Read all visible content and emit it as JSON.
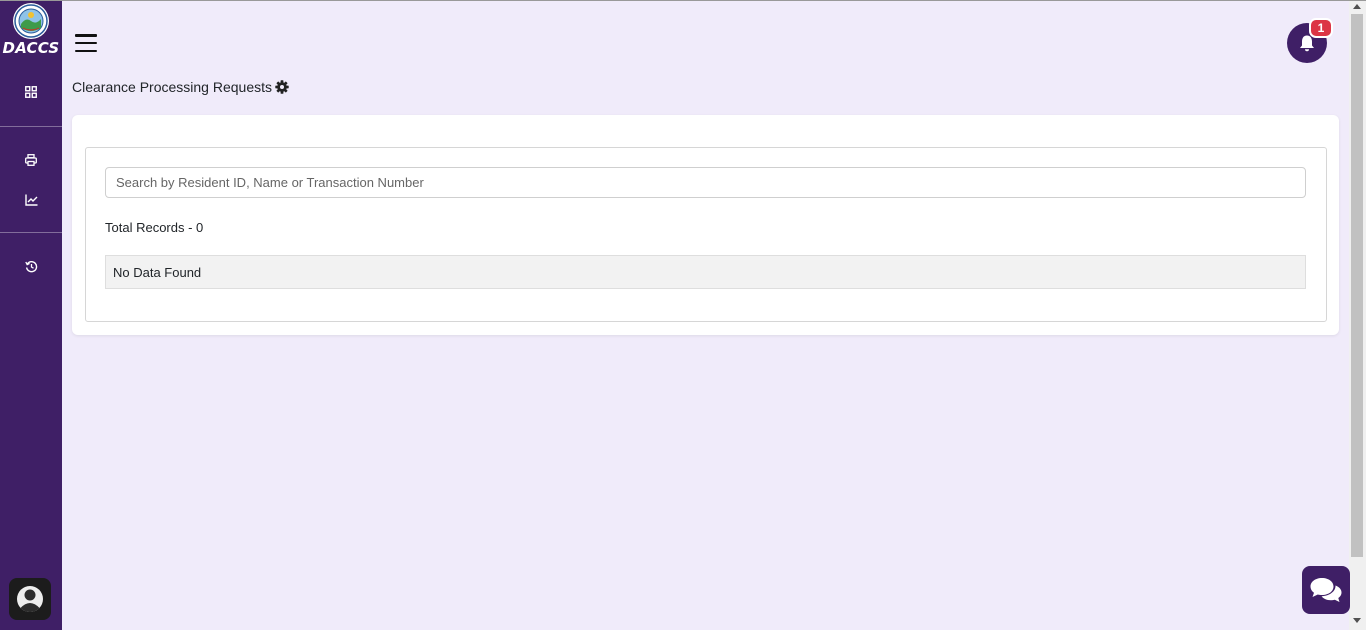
{
  "app": {
    "logo_text": "DACCS"
  },
  "sidebar": {
    "items": [
      {
        "icon": "dashboard-grid-icon"
      },
      {
        "icon": "printer-icon"
      },
      {
        "icon": "chart-line-icon"
      },
      {
        "icon": "history-icon"
      }
    ],
    "accent": "#3f1f66"
  },
  "header": {
    "notification_count": "1"
  },
  "page": {
    "title": "Clearance Processing Requests"
  },
  "search": {
    "placeholder": "Search by Resident ID, Name or Transaction Number",
    "value": ""
  },
  "records": {
    "total_label": "Total Records - 0",
    "empty_message": "No Data Found"
  },
  "colors": {
    "background": "#f0ebfa",
    "badge": "#dc3545"
  }
}
